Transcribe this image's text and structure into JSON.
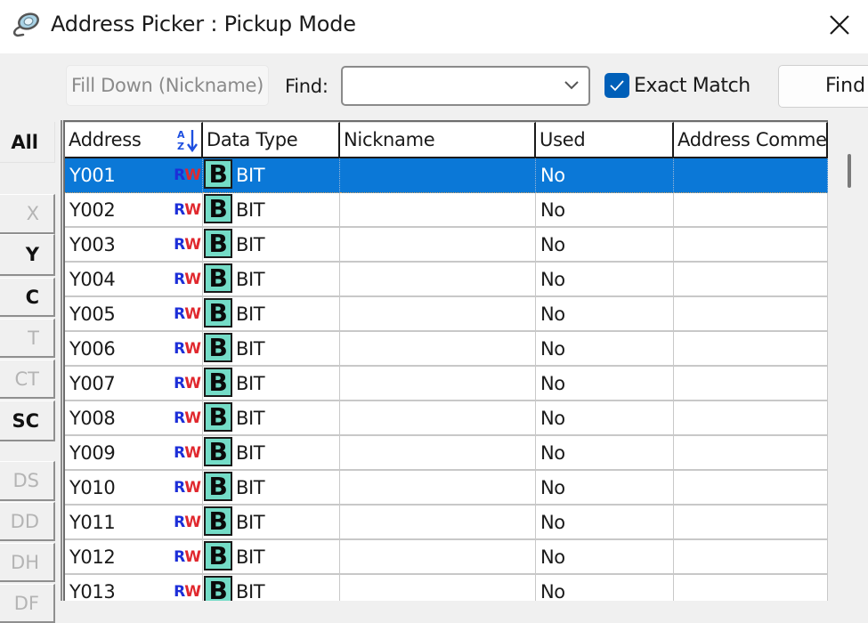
{
  "window": {
    "title": "Address Picker : Pickup Mode",
    "close_label": "✕"
  },
  "toolbar": {
    "fill_down_label": "Fill Down (Nickname)",
    "find_label": "Find:",
    "find_value": "",
    "exact_match_label": "Exact Match",
    "exact_match_checked": true,
    "find_button_label": "Find"
  },
  "sidebar": {
    "all_label": "All",
    "items": [
      {
        "label": "X",
        "enabled": false
      },
      {
        "label": "Y",
        "enabled": true
      },
      {
        "label": "C",
        "enabled": true
      },
      {
        "label": "T",
        "enabled": false
      },
      {
        "label": "CT",
        "enabled": false
      },
      {
        "label": "SC",
        "enabled": true
      },
      {
        "label": "DS",
        "enabled": false
      },
      {
        "label": "DD",
        "enabled": false
      },
      {
        "label": "DH",
        "enabled": false
      },
      {
        "label": "DF",
        "enabled": false
      }
    ]
  },
  "grid": {
    "columns": [
      "Address",
      "Data Type",
      "Nickname",
      "Used",
      "Address Comme"
    ],
    "access_label": {
      "r": "R",
      "w": "W"
    },
    "type_icon_letter": "B",
    "rows": [
      {
        "address": "Y001",
        "type": "BIT",
        "nickname": "",
        "used": "No",
        "comment": "",
        "selected": true
      },
      {
        "address": "Y002",
        "type": "BIT",
        "nickname": "",
        "used": "No",
        "comment": ""
      },
      {
        "address": "Y003",
        "type": "BIT",
        "nickname": "",
        "used": "No",
        "comment": ""
      },
      {
        "address": "Y004",
        "type": "BIT",
        "nickname": "",
        "used": "No",
        "comment": ""
      },
      {
        "address": "Y005",
        "type": "BIT",
        "nickname": "",
        "used": "No",
        "comment": ""
      },
      {
        "address": "Y006",
        "type": "BIT",
        "nickname": "",
        "used": "No",
        "comment": ""
      },
      {
        "address": "Y007",
        "type": "BIT",
        "nickname": "",
        "used": "No",
        "comment": ""
      },
      {
        "address": "Y008",
        "type": "BIT",
        "nickname": "",
        "used": "No",
        "comment": ""
      },
      {
        "address": "Y009",
        "type": "BIT",
        "nickname": "",
        "used": "No",
        "comment": ""
      },
      {
        "address": "Y010",
        "type": "BIT",
        "nickname": "",
        "used": "No",
        "comment": ""
      },
      {
        "address": "Y011",
        "type": "BIT",
        "nickname": "",
        "used": "No",
        "comment": ""
      },
      {
        "address": "Y012",
        "type": "BIT",
        "nickname": "",
        "used": "No",
        "comment": ""
      },
      {
        "address": "Y013",
        "type": "BIT",
        "nickname": "",
        "used": "No",
        "comment": ""
      }
    ]
  },
  "colors": {
    "selection": "#0b78d7",
    "checkbox": "#005fb8",
    "bit_icon": "#74dcc7",
    "read_flag": "#1d2fd8",
    "write_flag": "#e0282e"
  }
}
